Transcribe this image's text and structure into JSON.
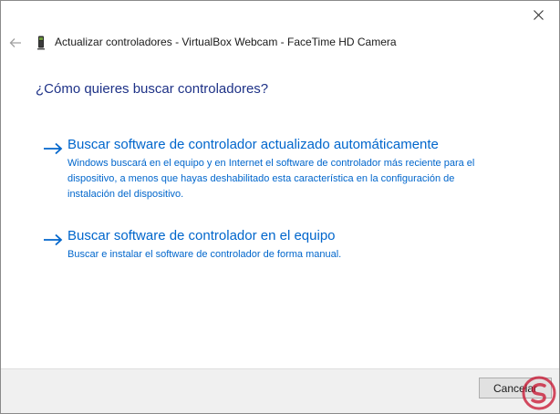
{
  "window": {
    "title": "Actualizar controladores - VirtualBox Webcam - FaceTime HD Camera"
  },
  "icons": {
    "close": "close-icon",
    "back": "back-arrow-icon",
    "device": "webcam-device-icon",
    "option_arrow": "arrow-right-icon"
  },
  "question": "¿Cómo quieres buscar controladores?",
  "options": [
    {
      "title": "Buscar software de controlador actualizado automáticamente",
      "description": "Windows buscará en el equipo y en Internet el software de controlador más reciente para el dispositivo, a menos que hayas deshabilitado esta característica en la configuración de instalación del dispositivo."
    },
    {
      "title": "Buscar software de controlador en el equipo",
      "description": "Buscar e instalar el software de controlador de forma manual."
    }
  ],
  "footer": {
    "cancel_label": "Cancelar"
  },
  "colors": {
    "link": "#0066cc",
    "heading": "#1e3287",
    "footer_bg": "#f0f0f0"
  }
}
